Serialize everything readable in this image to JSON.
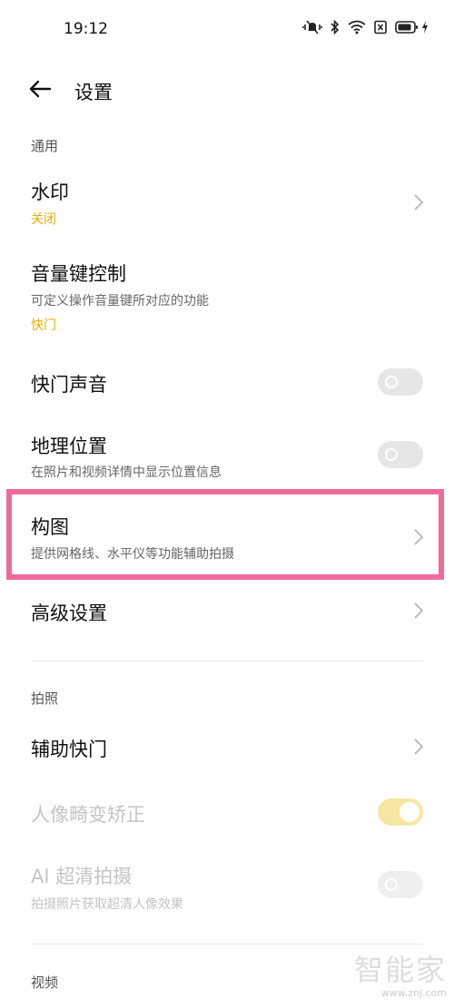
{
  "status_bar": {
    "time": "19:12",
    "icons": [
      "mute-vibrate-icon",
      "bluetooth-icon",
      "wifi-icon",
      "sim-card-icon",
      "battery-icon",
      "charging-icon"
    ]
  },
  "header": {
    "title": "设置",
    "back_icon": "back-arrow-icon"
  },
  "sections": {
    "general": "通用",
    "photo": "拍照",
    "video": "视频"
  },
  "general_items": {
    "watermark": {
      "title": "水印",
      "status": "关闭"
    },
    "volume_key": {
      "title": "音量键控制",
      "subtitle": "可定义操作音量键所对应的功能",
      "status": "快门"
    },
    "shutter_sound": {
      "title": "快门声音",
      "enabled": false
    },
    "location": {
      "title": "地理位置",
      "subtitle": "在照片和视频详情中显示位置信息",
      "enabled": false
    },
    "composition": {
      "title": "构图",
      "subtitle": "提供网格线、水平仪等功能辅助拍摄"
    },
    "advanced": {
      "title": "高级设置"
    }
  },
  "photo_items": {
    "assist_shutter": {
      "title": "辅助快门"
    },
    "portrait_distortion": {
      "title": "人像畸变矫正",
      "enabled": true,
      "disabled": true
    },
    "ai_hd": {
      "title": "AI 超清拍摄",
      "subtitle": "拍摄照片获取超清人像效果",
      "enabled": false,
      "disabled": true
    }
  },
  "watermark_overlay": {
    "text": "智能家",
    "url": "www.znj.com"
  },
  "colors": {
    "accent": "#e2b100",
    "highlight": "#f06b9a",
    "toggle_on": "#f5e7a3",
    "toggle_off": "#e6e6e6"
  }
}
